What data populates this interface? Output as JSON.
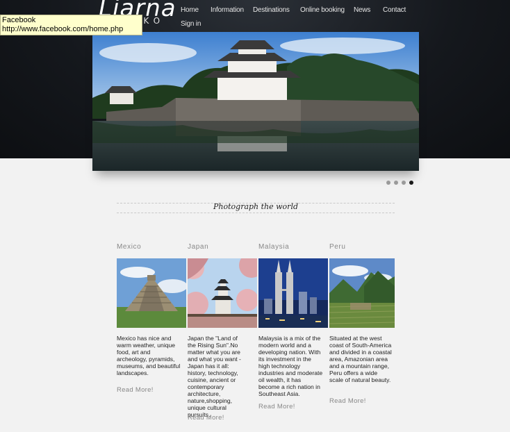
{
  "logo": {
    "main": "Liarna",
    "sub": "ABERKO"
  },
  "nav": {
    "home": "Home",
    "information": "Information",
    "destinations": "Destinations",
    "online_booking": "Online booking",
    "news": "News",
    "contact": "Contact",
    "sign_in": "Sign in"
  },
  "tooltip": {
    "title": "Facebook",
    "url": "http://www.facebook.com/home.php"
  },
  "slider": {
    "slide_count": 4,
    "active_slide": 4
  },
  "tagline": "Photograph the world",
  "destinations": [
    {
      "title": "Mexico",
      "text": "Mexico has nice and warm weather, unique food, art and archeology, pyramids, museums, and beautiful landscapes.",
      "read_more": "Read More!"
    },
    {
      "title": "Japan",
      "text": "Japan the \"Land of the Rising Sun\".No matter what you are and what you want - Japan has it all: history, technology, cuisine, ancient or contemporary architecture, nature,shopping, unique cultural pursuits.",
      "read_more": "Read More!"
    },
    {
      "title": "Malaysia",
      "text": "Malaysia is a mix of the modern world and a developing nation. With its investment in the high technology industries and moderate oil wealth, it has become a rich nation in Southeast Asia.",
      "read_more": "Read More!"
    },
    {
      "title": "Peru",
      "text": "Situated at the west coast of South-America and divided in a coastal area, Amazonian area and a mountain range, Peru offers a wide scale of natural beauty.",
      "read_more": "Read More!"
    }
  ]
}
